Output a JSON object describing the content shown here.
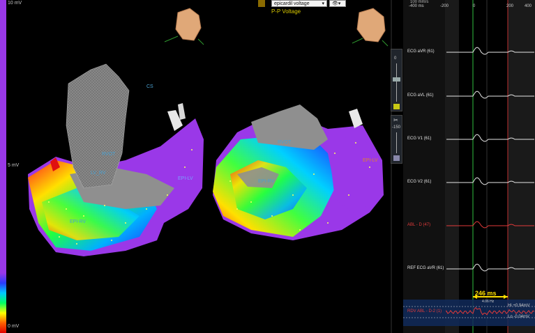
{
  "colorbar": {
    "top_label": "10 mV",
    "mid_label": "5 mV",
    "bottom_label": "0 mV"
  },
  "map_toolbar": {
    "map_select_value": "epicardil voltage",
    "map_subtitle": "P-P Voltage"
  },
  "map_labels": {
    "view1": [
      "CS",
      "RVOT",
      "LV_RV",
      "EPI-LV",
      "EPI-RV"
    ],
    "view2": [
      "RVOT",
      "EPI-RV",
      "EPI-LV"
    ]
  },
  "vcontrol": {
    "top_value": "0",
    "bottom_value": "-150"
  },
  "ecg": {
    "time_ticks": [
      "-400 ms",
      "-200",
      "0",
      "200",
      "400"
    ],
    "header_label": "100 mm/s",
    "leads": [
      {
        "label": "ECG aVR (61)",
        "color": "#e6e6e6"
      },
      {
        "label": "ECG aVL (61)",
        "color": "#e6e6e6"
      },
      {
        "label": "ECG V1 (61)",
        "color": "#e6e6e6"
      },
      {
        "label": "ECG V2 (61)",
        "color": "#e6e6e6"
      },
      {
        "label": "ABL - D (47)",
        "color": "#e23a3a"
      },
      {
        "label": "REF ECG aVR (61)",
        "color": "#e6e6e6"
      },
      {
        "label": "RDV ABL - D-2 (1)",
        "color": "#e23a3a"
      }
    ],
    "measurement": {
      "value": "246 ms",
      "sub": "4.06 Hz"
    },
    "hi_label": "Hi +0.94mV",
    "lo_label": "Lo -0.04mV"
  }
}
